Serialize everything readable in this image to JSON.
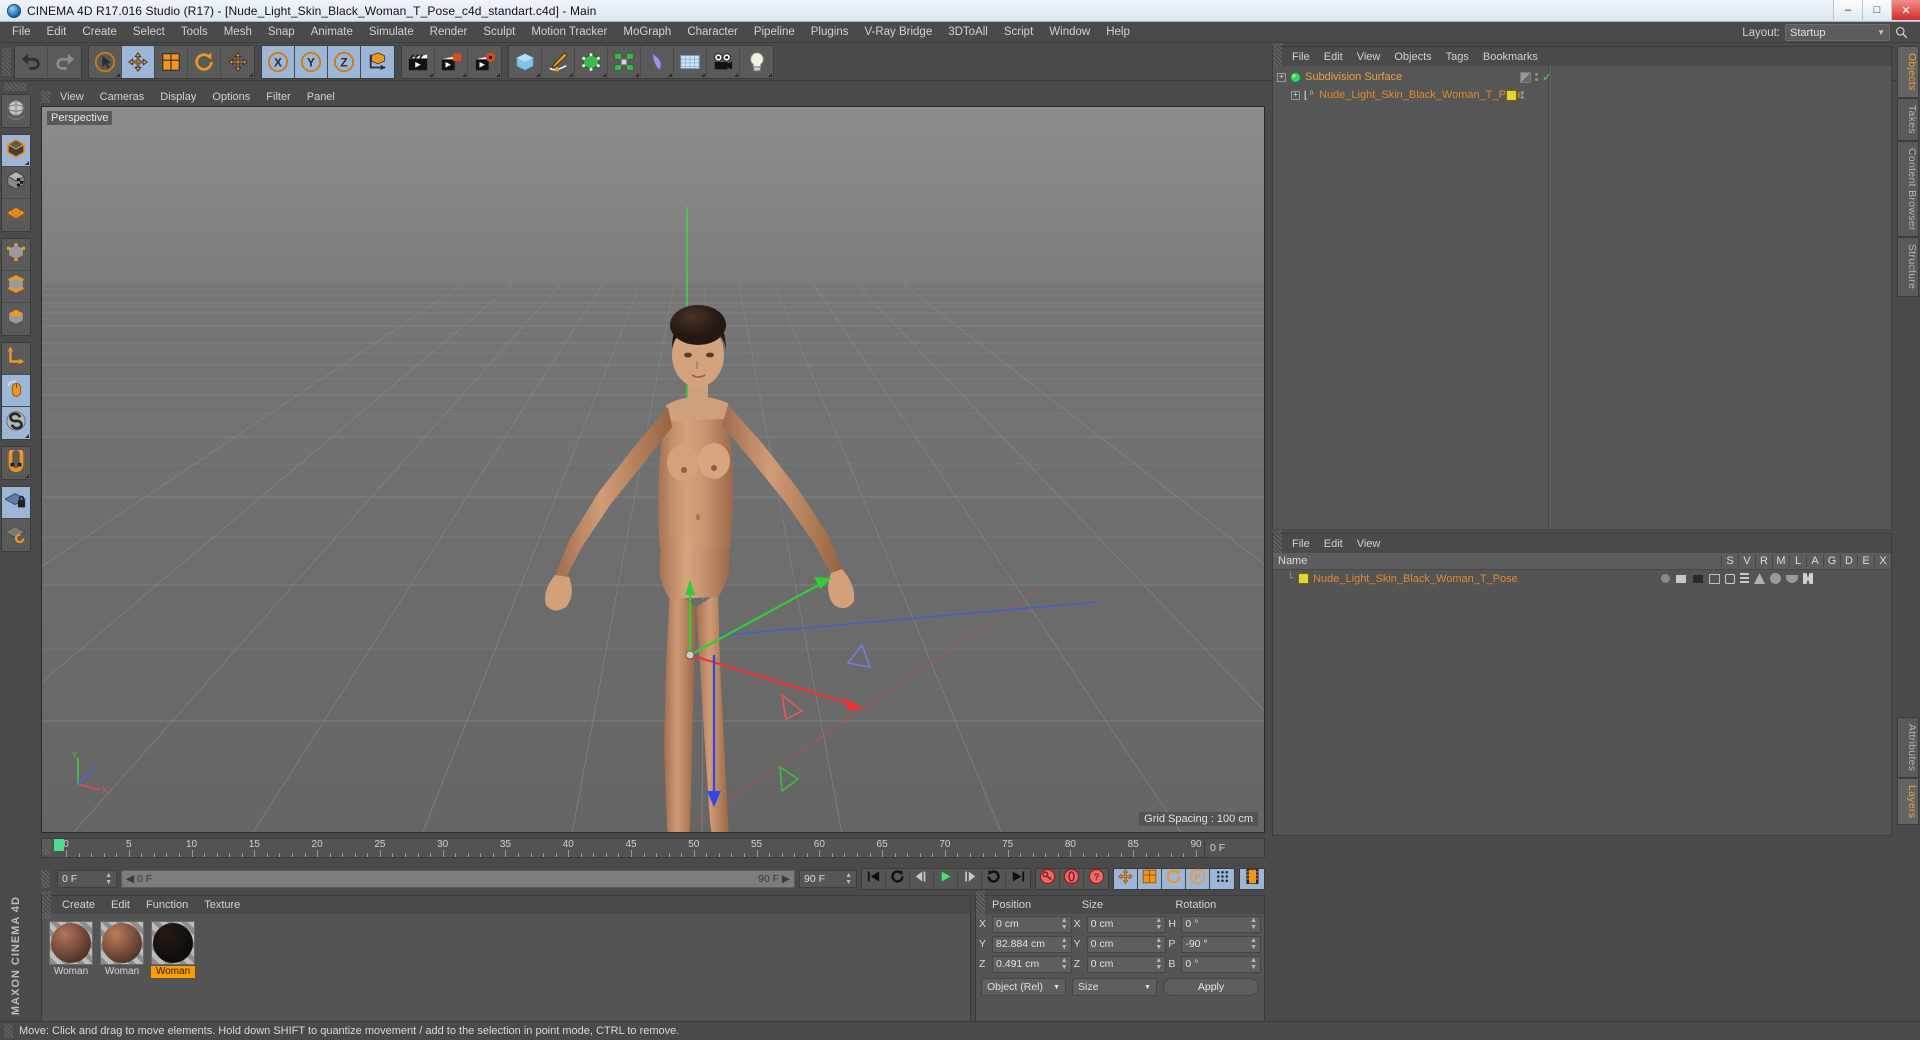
{
  "window": {
    "title": "CINEMA 4D R17.016 Studio (R17) - [Nude_Light_Skin_Black_Woman_T_Pose_c4d_standart.c4d] - Main",
    "app_icon": "cinema4d-logo-icon",
    "controls": {
      "minimize": "–",
      "maximize": "□",
      "close": "✕"
    }
  },
  "menubar": {
    "items": [
      "File",
      "Edit",
      "Create",
      "Select",
      "Tools",
      "Mesh",
      "Snap",
      "Animate",
      "Simulate",
      "Render",
      "Sculpt",
      "Motion Tracker",
      "MoGraph",
      "Character",
      "Pipeline",
      "Plugins",
      "V-Ray Bridge",
      "3DToAll",
      "Script",
      "Window",
      "Help"
    ],
    "layout_label": "Layout:",
    "layout_value": "Startup",
    "search_icon": "magnifier-icon"
  },
  "toolbar": {
    "groups": [
      {
        "buttons": [
          {
            "name": "undo-button",
            "icon": "undo-arrow-icon",
            "selected": false,
            "hasCorner": false
          },
          {
            "name": "redo-button",
            "icon": "redo-arrow-icon",
            "selected": false,
            "hasCorner": false
          }
        ]
      },
      {
        "buttons": [
          {
            "name": "live-selection-tool",
            "icon": "cursor-circle-icon",
            "selected": false,
            "hasCorner": true
          },
          {
            "name": "move-tool",
            "icon": "move-arrows-icon",
            "selected": true,
            "hasCorner": false
          },
          {
            "name": "scale-tool",
            "icon": "scale-cube-icon",
            "selected": false,
            "hasCorner": false
          },
          {
            "name": "rotate-tool",
            "icon": "rotate-circle-icon",
            "selected": false,
            "hasCorner": false
          },
          {
            "name": "move-duplicate-tool",
            "icon": "move-arrows-icon",
            "selected": false,
            "hasCorner": true
          }
        ]
      },
      {
        "buttons": [
          {
            "name": "lock-x-axis",
            "icon": "x-axis-icon",
            "selected": true,
            "hasCorner": false
          },
          {
            "name": "lock-y-axis",
            "icon": "y-axis-icon",
            "selected": true,
            "hasCorner": false
          },
          {
            "name": "lock-z-axis",
            "icon": "z-axis-icon",
            "selected": true,
            "hasCorner": false
          },
          {
            "name": "world-object-coordinates",
            "icon": "axis-cube-icon",
            "selected": true,
            "hasCorner": false
          }
        ]
      },
      {
        "buttons": [
          {
            "name": "render-view-button",
            "icon": "clapperboard-icon",
            "selected": false,
            "hasCorner": true
          },
          {
            "name": "render-to-picture-viewer",
            "icon": "clapperboard-picture-icon",
            "selected": false,
            "hasCorner": true
          },
          {
            "name": "render-settings-button",
            "icon": "clapperboard-gear-icon",
            "selected": false,
            "hasCorner": true
          }
        ]
      },
      {
        "buttons": [
          {
            "name": "add-cube-object",
            "icon": "blue-cube-icon",
            "selected": false,
            "hasCorner": true
          },
          {
            "name": "add-spline",
            "icon": "pen-spline-icon",
            "selected": false,
            "hasCorner": true
          },
          {
            "name": "add-generator",
            "icon": "green-cube-icon",
            "selected": false,
            "hasCorner": true
          },
          {
            "name": "add-mograph",
            "icon": "green-cluster-icon",
            "selected": false,
            "hasCorner": true
          },
          {
            "name": "add-deformer",
            "icon": "bend-deformer-icon",
            "selected": false,
            "hasCorner": true
          },
          {
            "name": "add-scene-environment",
            "icon": "floor-grid-icon",
            "selected": false,
            "hasCorner": true
          },
          {
            "name": "add-camera",
            "icon": "camera-icon",
            "selected": false,
            "hasCorner": true
          },
          {
            "name": "add-light",
            "icon": "lightbulb-icon",
            "selected": false,
            "hasCorner": true
          }
        ]
      }
    ]
  },
  "leftbar": {
    "groups": [
      {
        "buttons": [
          {
            "name": "undo-view-button",
            "icon": "globe-undo-icon",
            "selected": false,
            "hasCorner": false
          }
        ]
      },
      {
        "buttons": [
          {
            "name": "make-editable-button",
            "icon": "editable-cube-icon",
            "selected": true,
            "hasCorner": true
          },
          {
            "name": "model-mode-button",
            "icon": "checker-cube-icon",
            "selected": false,
            "hasCorner": false
          },
          {
            "name": "texture-mode-button",
            "icon": "texture-grid-icon",
            "selected": false,
            "hasCorner": false
          }
        ]
      },
      {
        "buttons": [
          {
            "name": "points-mode-button",
            "icon": "points-cube-icon",
            "selected": false,
            "hasCorner": false
          },
          {
            "name": "edges-mode-button",
            "icon": "edges-cube-icon",
            "selected": false,
            "hasCorner": false
          },
          {
            "name": "polygons-mode-button",
            "icon": "polygon-cube-icon",
            "selected": false,
            "hasCorner": false
          }
        ]
      },
      {
        "buttons": [
          {
            "name": "object-axis-mode-button",
            "icon": "axis-L-icon",
            "selected": false,
            "hasCorner": false
          },
          {
            "name": "viewport-solo-button",
            "icon": "mouse-icon",
            "selected": true,
            "hasCorner": false
          },
          {
            "name": "enable-snap-button",
            "icon": "s-disc-icon",
            "selected": true,
            "hasCorner": true
          }
        ]
      },
      {
        "buttons": [
          {
            "name": "magnet-tool-button",
            "icon": "magnet-icon",
            "selected": false,
            "hasCorner": true
          }
        ]
      },
      {
        "buttons": [
          {
            "name": "workplane-lock-button",
            "icon": "grid-lock-icon",
            "selected": true,
            "hasCorner": false
          },
          {
            "name": "workplane-reset-button",
            "icon": "grid-rotate-icon",
            "selected": false,
            "hasCorner": false
          }
        ]
      }
    ],
    "brand": "MAXON CINEMA 4D"
  },
  "viewport": {
    "menu": [
      "View",
      "Cameras",
      "Display",
      "Options",
      "Filter",
      "Panel"
    ],
    "label": "Perspective",
    "grid_spacing": "Grid Spacing : 100 cm",
    "axis_labels": {
      "x": "X",
      "y": "Y",
      "z": "Z"
    }
  },
  "timeline": {
    "ticks": [
      0,
      5,
      10,
      15,
      20,
      25,
      30,
      35,
      40,
      45,
      50,
      55,
      60,
      65,
      70,
      75,
      80,
      85,
      90
    ],
    "current_frame_marker": 0,
    "right_field": "0 F"
  },
  "playbar": {
    "current_frame": "0 F",
    "range_start": "0 F",
    "range_end": "90 F",
    "max_frame": "90 F",
    "transport": [
      {
        "name": "go-to-start-button",
        "icon": "skip-start-icon"
      },
      {
        "name": "play-backwards-loop-button",
        "icon": "loop-ccw-icon"
      },
      {
        "name": "step-back-button",
        "icon": "step-back-icon"
      },
      {
        "name": "play-button",
        "icon": "play-icon"
      },
      {
        "name": "step-forward-button",
        "icon": "step-forward-icon"
      },
      {
        "name": "play-loop-button",
        "icon": "loop-cw-icon"
      },
      {
        "name": "go-to-end-button",
        "icon": "skip-end-icon"
      }
    ],
    "record": [
      {
        "name": "record-active-objects-button",
        "icon": "key-icon"
      },
      {
        "name": "autokeying-button",
        "icon": "autokey-icon"
      },
      {
        "name": "keyframe-selection-button",
        "icon": "question-key-icon"
      }
    ],
    "keyflags": [
      {
        "name": "record-position-button",
        "icon": "position-arrows-icon",
        "selected": true
      },
      {
        "name": "record-scale-button",
        "icon": "scale-icon",
        "selected": true
      },
      {
        "name": "record-rotation-button",
        "icon": "rotation-icon",
        "selected": true
      },
      {
        "name": "record-parameter-button",
        "icon": "parameter-P-icon",
        "selected": true
      },
      {
        "name": "record-pla-button",
        "icon": "point-level-anim-icon",
        "selected": true
      }
    ],
    "extra": [
      {
        "name": "timeline-toggle-button",
        "icon": "filmstrip-icon",
        "selected": true
      }
    ]
  },
  "material_manager": {
    "menu": [
      "Create",
      "Edit",
      "Function",
      "Texture"
    ],
    "materials": [
      {
        "name": "Woman",
        "color": "#b4745a",
        "selected": false
      },
      {
        "name": "Woman",
        "color": "#bd7b5c",
        "selected": false
      },
      {
        "name": "Woman",
        "color": "#241a14",
        "selected": true
      }
    ]
  },
  "coordinates": {
    "headers": {
      "position": "Position",
      "size": "Size",
      "rotation": "Rotation"
    },
    "rows": [
      {
        "pos_label": "X",
        "pos_value": "0 cm",
        "size_label": "X",
        "size_value": "0 cm",
        "rot_label": "H",
        "rot_value": "0 °"
      },
      {
        "pos_label": "Y",
        "pos_value": "82.884 cm",
        "size_label": "Y",
        "size_value": "0 cm",
        "rot_label": "P",
        "rot_value": "-90 °"
      },
      {
        "pos_label": "Z",
        "pos_value": "0.491 cm",
        "size_label": "Z",
        "size_value": "0 cm",
        "rot_label": "B",
        "rot_value": "0 °"
      }
    ],
    "mode_select": "Object (Rel)",
    "size_select": "Size",
    "apply_label": "Apply"
  },
  "object_manager": {
    "menu": [
      "File",
      "Edit",
      "View",
      "Objects",
      "Tags",
      "Bookmarks"
    ],
    "rows": [
      {
        "name": "Subdivision Surface",
        "icon": "subdivision-surface-icon",
        "depth": 0,
        "tag_color": "",
        "check": true
      },
      {
        "name": "Nude_Light_Skin_Black_Woman_T_Pose",
        "icon": "polygon-object-icon",
        "depth": 1,
        "tag_color": "#e8d23a",
        "check": false
      }
    ]
  },
  "object_manager_2": {
    "menu": [
      "File",
      "Edit",
      "View"
    ],
    "columns": [
      "Name",
      "S",
      "V",
      "R",
      "M",
      "L",
      "A",
      "G",
      "D",
      "E",
      "X"
    ],
    "rows": [
      {
        "name": "Nude_Light_Skin_Black_Woman_T_Pose",
        "swatch": "#e8d23a"
      }
    ]
  },
  "right_tabs": {
    "top": [
      {
        "label": "Objects",
        "active": true
      },
      {
        "label": "Takes",
        "active": false
      },
      {
        "label": "Content Browser",
        "active": false
      },
      {
        "label": "Structure",
        "active": false
      }
    ],
    "bottom": [
      {
        "label": "Attributes",
        "active": false
      },
      {
        "label": "Layers",
        "active": true
      }
    ]
  },
  "statusbar": {
    "text": "Move: Click and drag to move elements. Hold down SHIFT to quantize movement / add to the selection in point mode, CTRL to remove."
  }
}
